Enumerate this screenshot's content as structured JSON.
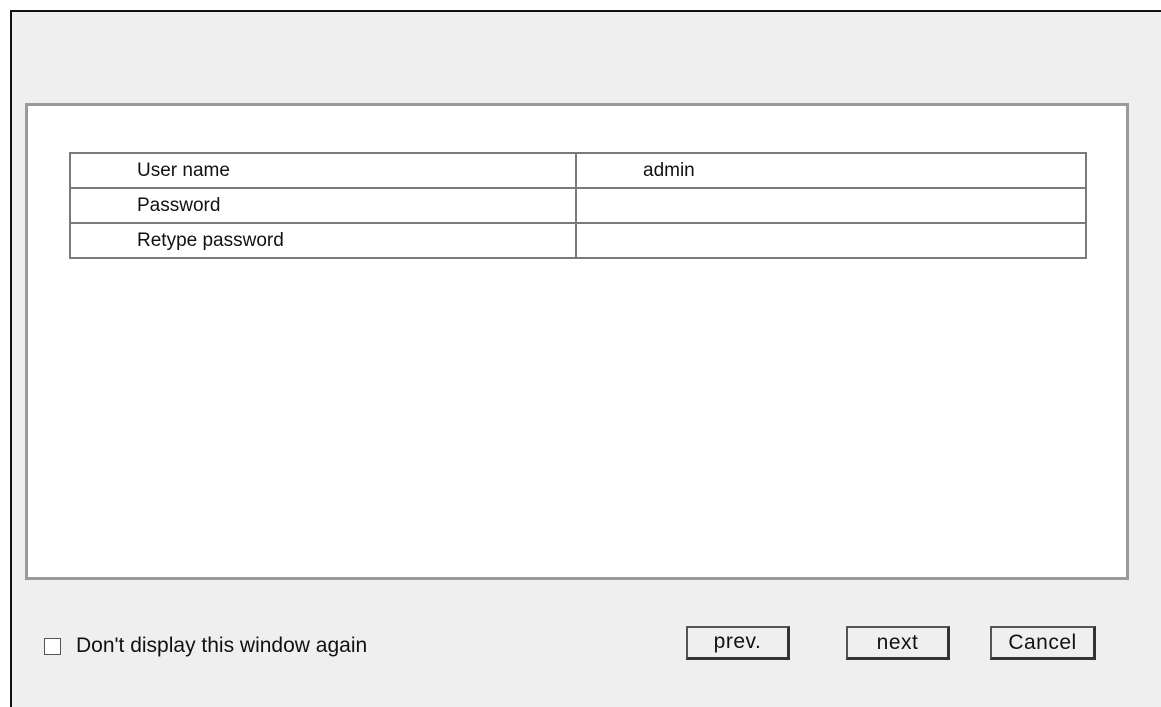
{
  "form": {
    "rows": [
      {
        "label": "User name",
        "value": "admin"
      },
      {
        "label": "Password",
        "value": ""
      },
      {
        "label": "Retype password",
        "value": ""
      }
    ]
  },
  "footer": {
    "checkbox_label": "Don't display this window again",
    "checkbox_checked": false,
    "prev_label": "prev.",
    "next_label": "next",
    "cancel_label": "Cancel"
  }
}
